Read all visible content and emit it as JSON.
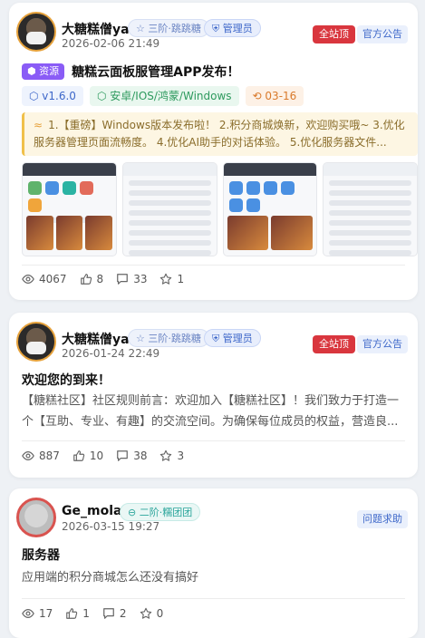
{
  "posts": [
    {
      "author": "大糖糕僧ya",
      "level": "三阶·跳跳糖",
      "role": "管理员",
      "date": "2026-02-06 21:49",
      "pinned": "全站顶",
      "category": "官方公告",
      "resource_badge": "资源",
      "title": "糖糕云面板服管理APP发布！",
      "chips": [
        "v1.6.0",
        "安卓/IOS/鸿蒙/Windows",
        "03-16"
      ],
      "notice": "1.【重磅】Windows版本发布啦！ 2.积分商城焕新，欢迎购买哦~ 3.优化服务器管理页面流畅度。 4.优化AI助手的对话体验。 5.优化服务器文件...",
      "views": "4067",
      "likes": "8",
      "comments": "33",
      "stars": "1"
    },
    {
      "author": "大糖糕僧ya",
      "level": "三阶·跳跳糖",
      "role": "管理员",
      "date": "2026-01-24 22:49",
      "pinned": "全站顶",
      "category": "官方公告",
      "title": "欢迎您的到来！",
      "excerpt": "【糖糕社区】社区规则前言：欢迎加入【糖糕社区】！我们致力于打造一个【互助、专业、有趣】的交流空间。为确保每位成员的权益，营造良...",
      "views": "887",
      "likes": "10",
      "comments": "38",
      "stars": "3"
    },
    {
      "author": "Ge_mola",
      "level": "二阶·糯团团",
      "date": "2026-03-15 19:27",
      "category": "问题求助",
      "title": "服务器",
      "excerpt": "应用端的积分商城怎么还没有搞好",
      "views": "17",
      "likes": "1",
      "comments": "2",
      "stars": "0"
    }
  ],
  "colors": {
    "pin": "#d9363e",
    "admin": "#3d67c9",
    "resource": "#8a5cf6",
    "notice_bg": "#fdf6e3"
  },
  "icons": [
    "eye-icon",
    "thumb-up-icon",
    "comment-icon",
    "star-icon",
    "shield-icon",
    "cube-icon"
  ]
}
